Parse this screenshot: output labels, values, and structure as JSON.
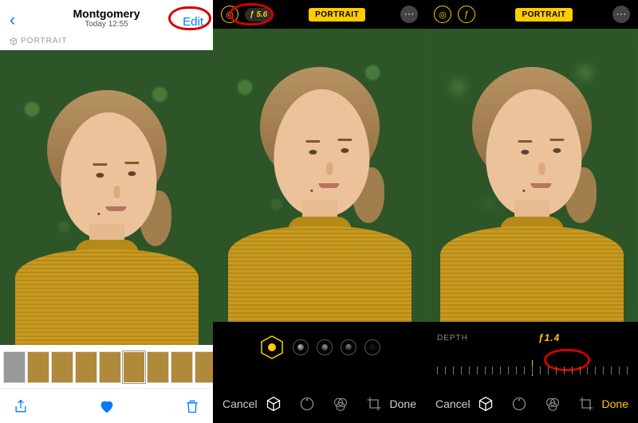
{
  "panel1": {
    "back_glyph": "‹",
    "title": "Montgomery",
    "subtitle": "Today  12:55",
    "edit_label": "Edit",
    "mode_tag": "PORTRAIT",
    "toolbar": {
      "share": "share-icon",
      "favorite": "heart-icon",
      "trash": "trash-icon"
    }
  },
  "panel2": {
    "f_value": "ƒ 5.6",
    "mode_badge": "PORTRAIT",
    "cancel": "Cancel",
    "done": "Done"
  },
  "panel3": {
    "flash": "ƒ",
    "mode_badge": "PORTRAIT",
    "depth_label": "DEPTH",
    "depth_value": "ƒ1.4",
    "cancel": "Cancel",
    "done": "Done"
  },
  "edit_tools": [
    "portrait-cube-icon",
    "adjust-dial-icon",
    "filters-icon",
    "crop-icon"
  ]
}
